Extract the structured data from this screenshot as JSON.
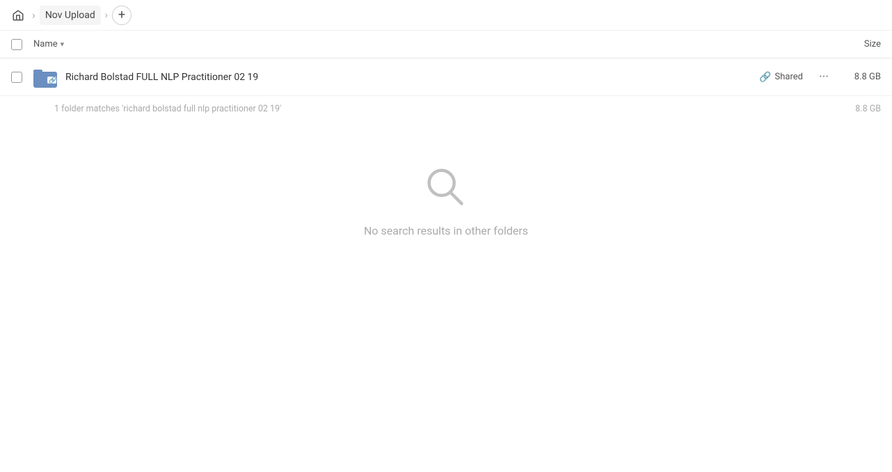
{
  "breadcrumb": {
    "home_label": "Home",
    "separator": "›",
    "folder_name": "Nov Upload",
    "add_button_label": "+"
  },
  "columns": {
    "name_label": "Name",
    "name_sort_icon": "▾",
    "size_label": "Size"
  },
  "file_row": {
    "name": "Richard Bolstad FULL NLP Practitioner 02 19",
    "shared_label": "Shared",
    "size": "8.8 GB",
    "more_icon": "···"
  },
  "match_info": {
    "text": "1 folder matches 'richard bolstad full nlp practitioner 02 19'",
    "size": "8.8 GB"
  },
  "empty_state": {
    "message": "No search results in other folders"
  }
}
